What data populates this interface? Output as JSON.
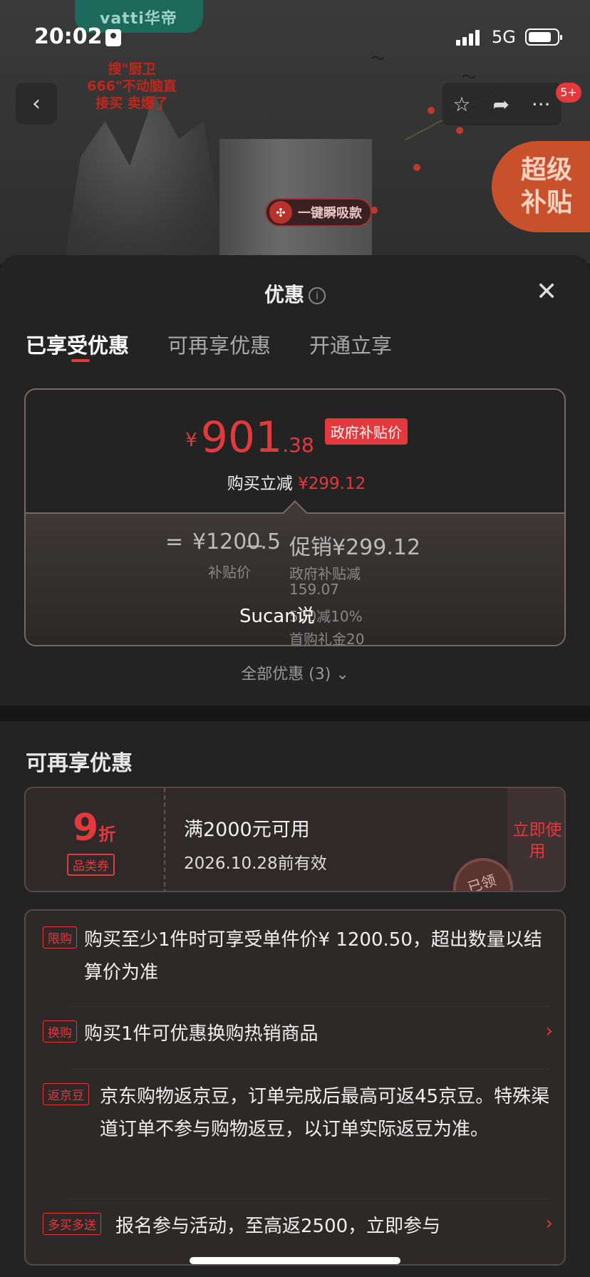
{
  "status_bar": {
    "time": "20:02",
    "network": "5G"
  },
  "banner": {
    "brand": "vatti华帝",
    "promo": "搜\"厨卫666\"不动脑直接买 卖爆了",
    "feature": "一键瞬吸款",
    "subsidy": "超级补贴",
    "cart_badge": "5+"
  },
  "sheet": {
    "title": "优惠",
    "close": "✕"
  },
  "tabs": [
    {
      "label": "已享受优惠",
      "active": true
    },
    {
      "label": "可再享优惠",
      "active": false
    },
    {
      "label": "开通立享",
      "active": false
    }
  ],
  "price_card": {
    "currency": "¥",
    "price_int": "901",
    "price_dec": ".38",
    "tag": "政府补贴价",
    "reduce_label": "购买立减",
    "reduce_amount": "¥299.12",
    "eq": "=",
    "base_price": "¥1200.5",
    "base_label": "补贴价",
    "minus": "－",
    "promo_total": "促销¥299.12",
    "promo_items": [
      "政府补贴减",
      "159.07",
      "500减10%",
      "首购礼金20"
    ]
  },
  "watermark": "Sucan说",
  "all_offers": "全部优惠 (3)",
  "more_section": {
    "title": "可再享优惠",
    "coupon": {
      "discount_num": "9",
      "discount_unit": "折",
      "category": "品类券",
      "condition": "满2000元可用",
      "valid": "2026.10.28前有效",
      "use_label": "立即使用",
      "stamp": "已领"
    }
  },
  "notes": [
    {
      "tag": "限购",
      "text": "购买至少1件时可享受单件价¥ 1200.50，超出数量以结算价为准",
      "arrow": false
    },
    {
      "tag": "换购",
      "text": "购买1件可优惠换购热销商品",
      "arrow": true
    },
    {
      "tag": "返京豆",
      "text": "京东购物返京豆，订单完成后最高可返45京豆。特殊渠道订单不参与购物返豆，以订单实际返豆为准。",
      "arrow": false
    },
    {
      "tag": "多买多送",
      "text": "报名参与活动，至高返2500，立即参与",
      "arrow": true
    }
  ],
  "colors": {
    "accent": "#e4393c",
    "sheet_bg": "#232323"
  }
}
